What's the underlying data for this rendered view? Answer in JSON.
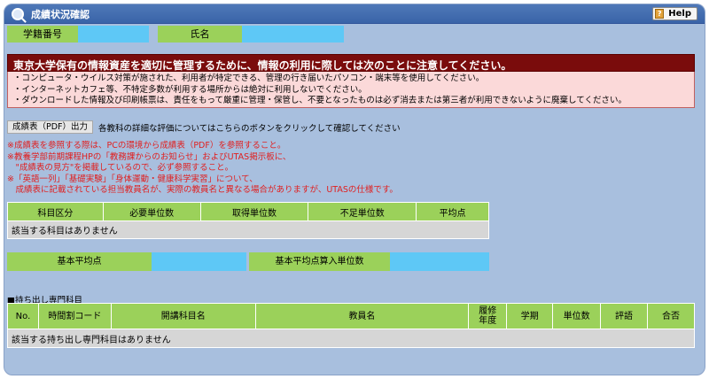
{
  "window": {
    "title": "成績状況確認",
    "help_label": "Help"
  },
  "student": {
    "id_label": "学籍番号",
    "name_label": "氏名"
  },
  "warning": {
    "title": "東京大学保有の情報資産を適切に管理するために、情報の利用に際しては次のことに注意してください。",
    "lines": [
      "・コンピュータ・ウイルス対策が施された、利用者が特定できる、管理の行き届いたパソコン・端末等を使用してください。",
      "・インターネットカフェ等、不特定多数が利用する場所からは絶対に利用しないでください。",
      "・ダウンロードした情報及び印刷帳票は、責任をもって厳重に管理・保管し、不要となったものは必ず消去または第三者が利用できないように廃棄してください。"
    ]
  },
  "pdf": {
    "button_label": "成績表（PDF）出力",
    "description": "各教科の詳細な評価についてはこちらのボタンをクリックして確認してください"
  },
  "notes": [
    "※成績表を参照する際は、PCの環境から成績表（PDF）を参照すること。",
    "※教養学部前期課程HPの「教務課からのお知らせ」およびUTAS掲示板に、",
    "　\"成績表の見方\"を掲載しているので、必ず参照すること。",
    "※「英語一列」「基礎実験」「身体運動・健康科学実習」について、",
    "　成績表に記載されている担当教員名が、実際の教員名と異なる場合がありますが、UTASの仕様です。"
  ],
  "credits_table": {
    "headers": [
      "科目区分",
      "必要単位数",
      "取得単位数",
      "不足単位数",
      "平均点"
    ],
    "empty_message": "該当する科目はありません"
  },
  "averages": {
    "basic_avg_label": "基本平均点",
    "basic_avg_units_label": "基本平均点算入単位数"
  },
  "carryout": {
    "section_title": "■持ち出し専門科目",
    "headers": [
      "No.",
      "時間割コード",
      "開講科目名",
      "教員名",
      "履修年度",
      "学期",
      "単位数",
      "評語",
      "合否"
    ],
    "empty_message": "該当する持ち出し専門科目はありません"
  },
  "colors": {
    "title_bar": "#3a64a8",
    "panel_bg": "#a8bfde",
    "header_green": "#9bd15a",
    "value_blue": "#5ec8f6",
    "warning_dark": "#7a0c0c",
    "warning_light": "#fbd9d9",
    "note_red": "#e02020"
  }
}
